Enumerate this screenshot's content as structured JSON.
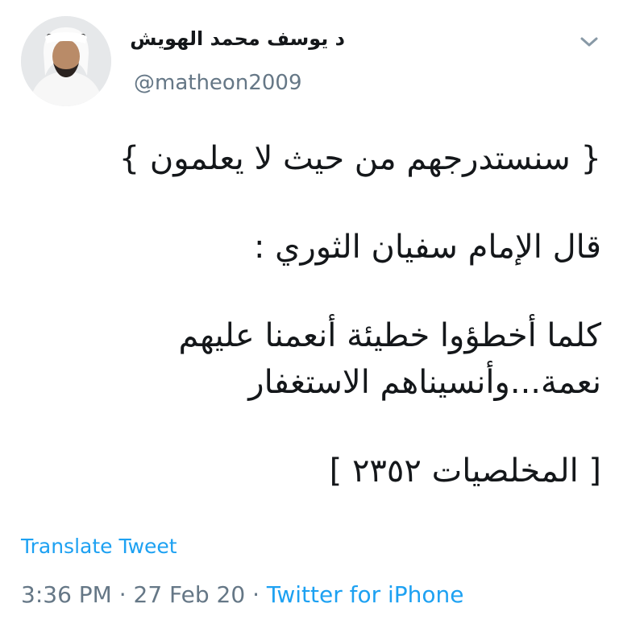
{
  "author": {
    "display_name": "د يوسف محمد الهويش",
    "handle": "@matheon2009"
  },
  "tweet": {
    "lines": [
      "{ سنستدرجهم من حيث لا يعلمون }",
      "قال الإمام سفيان الثوري  :",
      "كلما أخطؤوا خطيئة أنعمنا عليهم",
      "نعمة...وأنسيناهم الاستغفار",
      "[ المخلصيات ٢٣٥٢ ]"
    ]
  },
  "actions": {
    "translate_label": "Translate Tweet"
  },
  "meta": {
    "time": "3:36 PM",
    "date": "27 Feb 20",
    "separator": " · ",
    "source": "Twitter for iPhone"
  },
  "colors": {
    "link": "#1da1f2",
    "secondary_text": "#657786",
    "primary_text": "#14171a"
  },
  "icons": {
    "menu": "chevron-down-icon"
  }
}
